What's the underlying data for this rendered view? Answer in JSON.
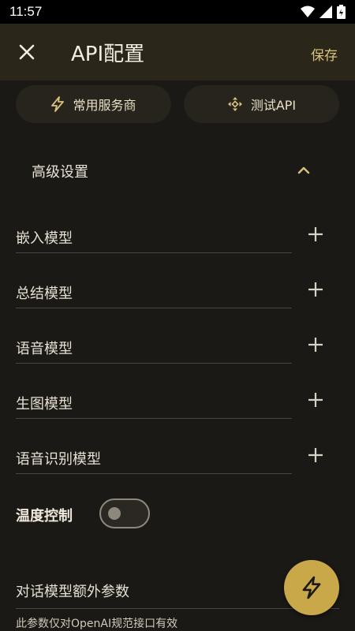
{
  "status_bar": {
    "time": "11:57"
  },
  "header": {
    "title": "API配置",
    "save_label": "保存"
  },
  "quick_actions": {
    "providers_label": "常用服务商",
    "test_label": "测试API"
  },
  "advanced": {
    "title": "高级设置",
    "models": [
      {
        "label": "嵌入模型"
      },
      {
        "label": "总结模型"
      },
      {
        "label": "语音模型"
      },
      {
        "label": "生图模型"
      },
      {
        "label": "语音识别模型"
      }
    ]
  },
  "temperature": {
    "label": "温度控制",
    "enabled": false
  },
  "extra_params": {
    "label": "对话模型额外参数",
    "hint": "此参数仅对OpenAI规范接口有效"
  },
  "colors": {
    "accent": "#d9c27d",
    "fab": "#c9a84a",
    "background": "#1b1915",
    "appbar": "#2a2619"
  }
}
